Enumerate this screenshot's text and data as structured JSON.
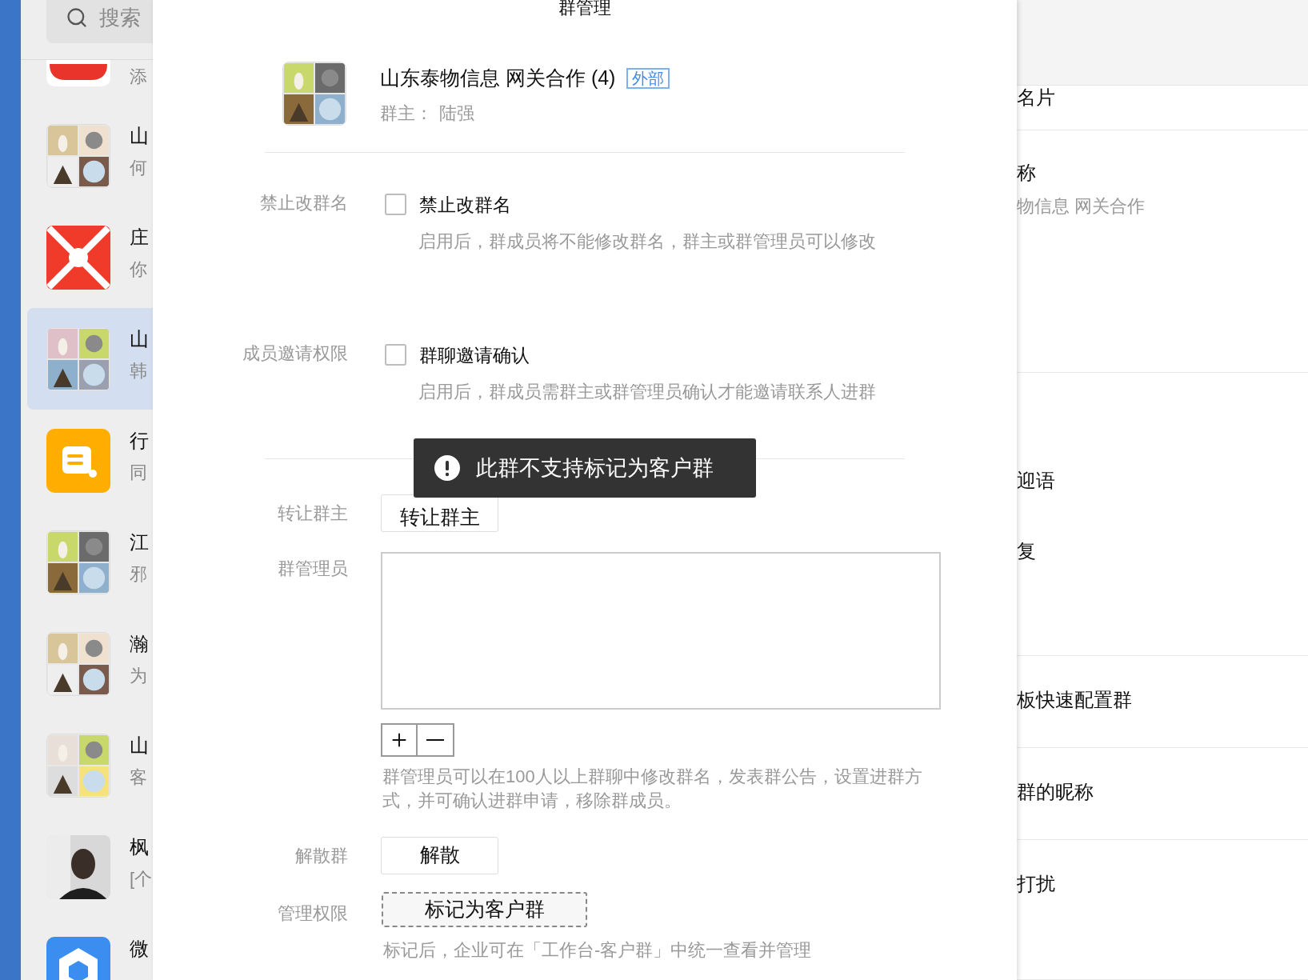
{
  "search": {
    "placeholder": "搜索"
  },
  "chats": [
    {
      "kind": "crm",
      "preview": "添",
      "selected": false
    },
    {
      "kind": "picture",
      "title": "山",
      "preview": "何",
      "selected": false
    },
    {
      "kind": "picture",
      "title": "庄",
      "preview": "你",
      "selected": false
    },
    {
      "kind": "picture",
      "title": "山",
      "preview": "韩",
      "selected": true
    },
    {
      "kind": "note",
      "title": "行",
      "preview": "同",
      "selected": false
    },
    {
      "kind": "picture",
      "title": "江",
      "preview": "邪",
      "selected": false
    },
    {
      "kind": "picture",
      "title": "瀚",
      "preview": "为",
      "selected": false
    },
    {
      "kind": "picture",
      "title": "山",
      "preview": "客",
      "selected": false
    },
    {
      "kind": "picture",
      "title": "枫",
      "preview": "[个",
      "selected": false
    },
    {
      "kind": "cube",
      "title": "微",
      "selected": false
    }
  ],
  "dialog": {
    "title": "群管理",
    "group": {
      "name": "山东泰物信息 网关合作 (4)",
      "tag": "外部",
      "owner_label": "群主：",
      "owner": "陆强"
    },
    "settings": [
      {
        "label": "禁止改群名",
        "option": "禁止改群名",
        "checked": false,
        "description": "启用后，群成员将不能修改群名，群主或群管理员可以修改"
      },
      {
        "label": "成员邀请权限",
        "option": "群聊邀请确认",
        "checked": false,
        "description": "启用后，群成员需群主或群管理员确认才能邀请联系人进群"
      }
    ],
    "transfer": {
      "label": "转让群主",
      "button": "转让群主"
    },
    "admins": {
      "label": "群管理员",
      "description": "群管理员可以在100人以上群聊中修改群名，发表群公告，设置进群方式，并可确认进群申请，移除群成员。"
    },
    "dissolve": {
      "label": "解散群",
      "button": "解散"
    },
    "permission": {
      "label": "管理权限",
      "button": "标记为客户群",
      "description": "标记后，企业可在「工作台-客户群」中统一查看并管理"
    }
  },
  "toast": {
    "text": "此群不支持标记为客户群"
  },
  "side_panel": {
    "sections": [
      {
        "items": [
          {
            "text": "名片"
          }
        ]
      },
      {
        "items": [
          {
            "text": "称",
            "subtitle": "物信息 网关合作"
          }
        ]
      },
      {
        "items": [
          {
            "text": "迎语"
          },
          {
            "text": "复"
          }
        ]
      },
      {
        "items": [
          {
            "text": "板快速配置群"
          }
        ]
      },
      {
        "items": [
          {
            "text": "群的昵称"
          }
        ]
      },
      {
        "items": [
          {
            "text": "打扰"
          }
        ]
      }
    ]
  }
}
